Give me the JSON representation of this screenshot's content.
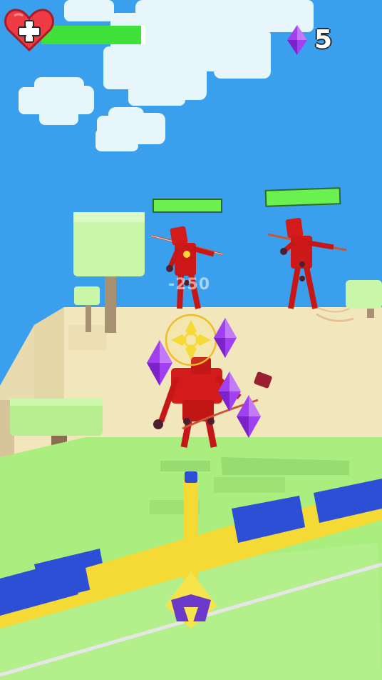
{
  "hud": {
    "health_fraction": 0.96,
    "gem_count": "5",
    "damage_popup": "-250"
  },
  "enemies": [
    {
      "name": "archer-left",
      "health_fraction": 1.0
    },
    {
      "name": "archer-right",
      "health_fraction": 1.0
    },
    {
      "name": "archer-near",
      "health_fraction": null
    }
  ],
  "colors": {
    "sky": "#3aa0ee",
    "health": "#3fe13a",
    "heart": "#ef3b44",
    "gem": "#a140f0",
    "enemy": "#d41b1b",
    "ground": "#a8f27e",
    "bow_yellow": "#f5d934",
    "bow_blue": "#2d4fd6"
  },
  "icons": [
    "heart-plus-icon",
    "gem-icon",
    "crosshair-icon"
  ]
}
